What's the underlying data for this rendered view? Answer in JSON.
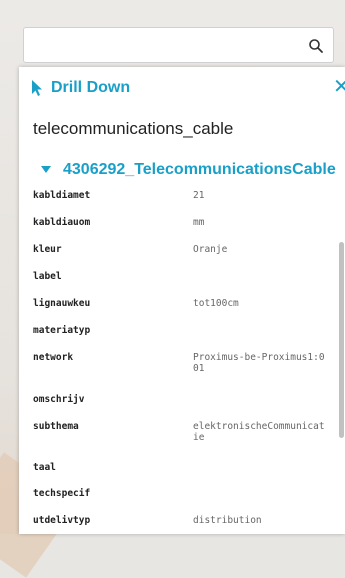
{
  "search": {
    "placeholder": "",
    "value": ""
  },
  "panel": {
    "title": "Drill Down",
    "close": "✕",
    "layer_title": "telecommunications_cable",
    "feature_title": "4306292_TelecommunicationsCable",
    "attributes": [
      {
        "key": "kabldiamet",
        "value": "21"
      },
      {
        "key": "kabldiauom",
        "value": "mm"
      },
      {
        "key": "kleur",
        "value": "Oranje"
      },
      {
        "key": "label",
        "value": ""
      },
      {
        "key": "lignauwkeu",
        "value": "tot100cm"
      },
      {
        "key": "materiatyp",
        "value": ""
      },
      {
        "key": "network",
        "value": "Proximus-be-Proximus1:001"
      },
      {
        "key": "omschrijv",
        "value": ""
      },
      {
        "key": "subthema",
        "value": "elektronischeCommunicatie"
      },
      {
        "key": "taal",
        "value": ""
      },
      {
        "key": "techspecif",
        "value": ""
      },
      {
        "key": "utdelivtyp",
        "value": "distribution"
      }
    ]
  },
  "colors": {
    "accent": "#1aa0c8"
  },
  "icons": {
    "search": "search-icon",
    "cursor": "cursor-pointer-icon",
    "caret": "caret-down-icon",
    "close": "close-icon"
  }
}
